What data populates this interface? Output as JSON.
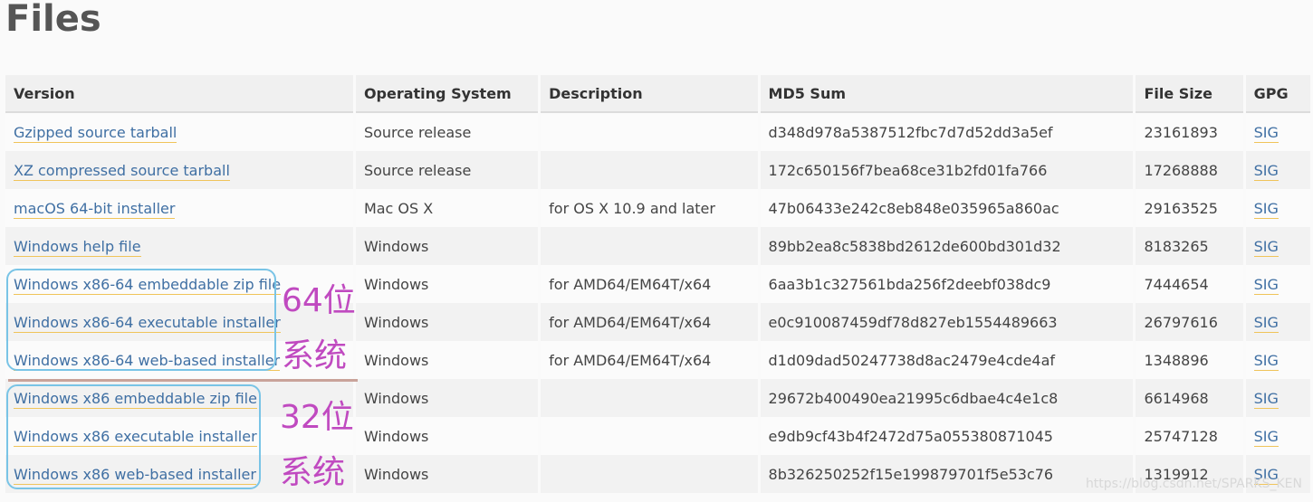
{
  "page": {
    "title": "Files"
  },
  "table": {
    "headers": [
      "Version",
      "Operating System",
      "Description",
      "MD5 Sum",
      "File Size",
      "GPG"
    ],
    "rows": [
      {
        "version": "Gzipped source tarball",
        "os": "Source release",
        "description": "",
        "md5": "d348d978a5387512fbc7d7d52dd3a5ef",
        "size": "23161893",
        "gpg": "SIG"
      },
      {
        "version": "XZ compressed source tarball",
        "os": "Source release",
        "description": "",
        "md5": "172c650156f7bea68ce31b2fd01fa766",
        "size": "17268888",
        "gpg": "SIG"
      },
      {
        "version": "macOS 64-bit installer",
        "os": "Mac OS X",
        "description": "for OS X 10.9 and later",
        "md5": "47b06433e242c8eb848e035965a860ac",
        "size": "29163525",
        "gpg": "SIG"
      },
      {
        "version": "Windows help file",
        "os": "Windows",
        "description": "",
        "md5": "89bb2ea8c5838bd2612de600bd301d32",
        "size": "8183265",
        "gpg": "SIG"
      },
      {
        "version": "Windows x86-64 embeddable zip file",
        "os": "Windows",
        "description": "for AMD64/EM64T/x64",
        "md5": "6aa3b1c327561bda256f2deebf038dc9",
        "size": "7444654",
        "gpg": "SIG"
      },
      {
        "version": "Windows x86-64 executable installer",
        "os": "Windows",
        "description": "for AMD64/EM64T/x64",
        "md5": "e0c910087459df78d827eb1554489663",
        "size": "26797616",
        "gpg": "SIG"
      },
      {
        "version": "Windows x86-64 web-based installer",
        "os": "Windows",
        "description": "for AMD64/EM64T/x64",
        "md5": "d1d09dad50247738d8ac2479e4cde4af",
        "size": "1348896",
        "gpg": "SIG"
      },
      {
        "version": "Windows x86 embeddable zip file",
        "os": "Windows",
        "description": "",
        "md5": "29672b400490ea21995c6dbae4c4e1c8",
        "size": "6614968",
        "gpg": "SIG"
      },
      {
        "version": "Windows x86 executable installer",
        "os": "Windows",
        "description": "",
        "md5": "e9db9cf43b4f2472d75a055380871045",
        "size": "25747128",
        "gpg": "SIG"
      },
      {
        "version": "Windows x86 web-based installer",
        "os": "Windows",
        "description": "",
        "md5": "8b326250252f15e199879701f5e53c76",
        "size": "1319912",
        "gpg": "SIG"
      }
    ]
  },
  "annotations": {
    "group64": {
      "label_line1": "64位",
      "label_line2": "系统"
    },
    "group32": {
      "label_line1": "32位",
      "label_line2": "系统"
    },
    "box_color": "#79c4e6",
    "label_color": "#c04ac0"
  },
  "watermark": "https://blog.csdn.net/SPARKS_KEN",
  "colors": {
    "link": "#3f6fa3",
    "link_underline": "#f0c45a",
    "title": "#555555"
  }
}
